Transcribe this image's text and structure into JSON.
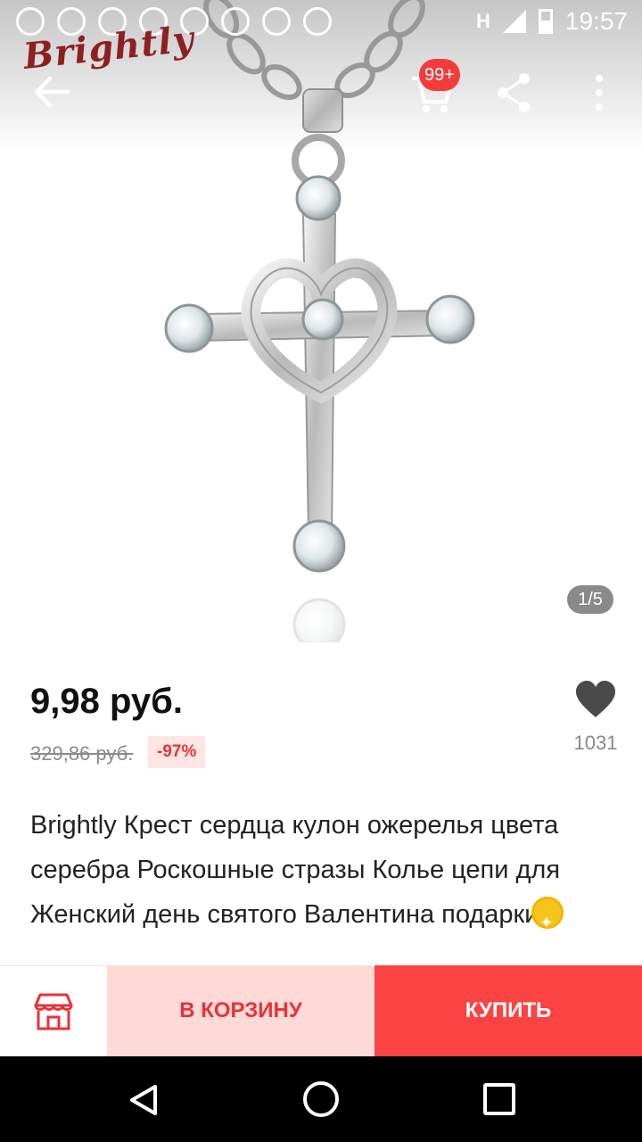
{
  "status_bar": {
    "time": "19:57",
    "network": "H"
  },
  "brand": {
    "name": "Brightly"
  },
  "toolbar": {
    "cart_badge": "99+"
  },
  "gallery": {
    "counter": "1/5"
  },
  "product": {
    "price": "9,98 руб.",
    "old_price": "329,86 руб.",
    "discount": "-97%",
    "favorites_count": "1031",
    "title": "Brightly Крест сердца кулон ожерелья цвета серебра Роскошные стразы Колье цепи для Женский день святого Валентина подарки"
  },
  "actions": {
    "add_to_cart": "В КОРЗИНУ",
    "buy": "КУПИТЬ"
  },
  "colors": {
    "accent": "#fa4343",
    "accent_light": "#ffdad6",
    "brand_red": "#8d2020"
  },
  "icons": [
    "arrow-back-icon",
    "cart-icon",
    "share-icon",
    "more-vert-icon",
    "heart-icon",
    "store-icon",
    "coin-icon",
    "nav-back-icon",
    "nav-home-icon",
    "nav-recent-icon"
  ]
}
